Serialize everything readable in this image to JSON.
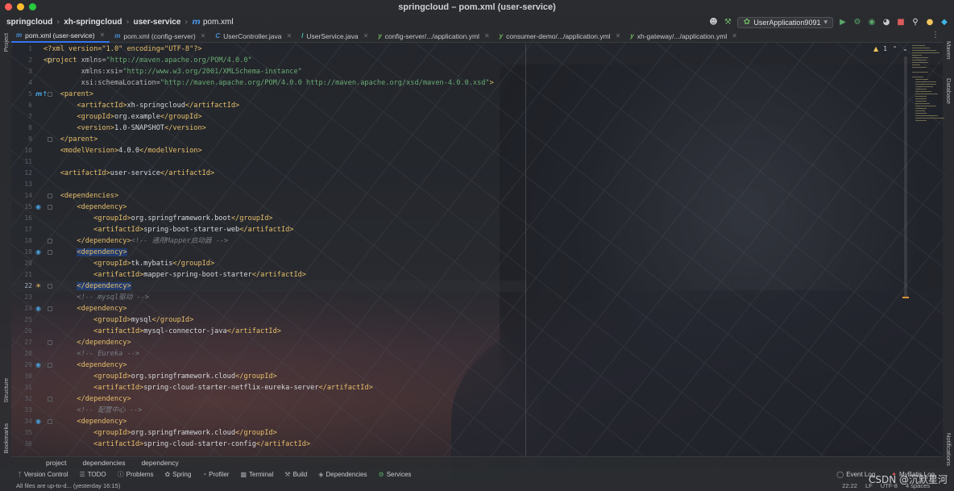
{
  "window": {
    "title": "springcloud – pom.xml (user-service)"
  },
  "breadcrumb": {
    "project": "springcloud",
    "module": "xh-springcloud",
    "submodule": "user-service",
    "file": "pom.xml"
  },
  "run_config": {
    "label": "UserApplication9091"
  },
  "tabs": [
    {
      "label": "pom.xml (user-service)",
      "icon": "maven-icon",
      "active": true
    },
    {
      "label": "pom.xml (config-server)",
      "icon": "maven-icon",
      "active": false
    },
    {
      "label": "UserController.java",
      "icon": "class-icon",
      "active": false
    },
    {
      "label": "UserService.java",
      "icon": "interface-icon",
      "active": false
    },
    {
      "label": "config-server/.../application.yml",
      "icon": "yaml-icon",
      "active": false
    },
    {
      "label": "consumer-demo/.../application.yml",
      "icon": "yaml-icon",
      "active": false
    },
    {
      "label": "xh-gateway/.../application.yml",
      "icon": "yaml-icon",
      "active": false
    }
  ],
  "left_stripe": {
    "project": "Project",
    "structure": "Structure",
    "bookmarks": "Bookmarks"
  },
  "right_stripe": {
    "maven": "Maven",
    "database": "Database",
    "notifications": "Notifications"
  },
  "inspection": {
    "warnings": "1"
  },
  "editor": {
    "current_line": 22,
    "line_numbers": [
      "1",
      "2",
      "3",
      "4",
      "5",
      "6",
      "7",
      "8",
      "9",
      "10",
      "11",
      "12",
      "13",
      "14",
      "15",
      "16",
      "17",
      "18",
      "19",
      "20",
      "21",
      "22",
      "23",
      "24",
      "25",
      "26",
      "27",
      "28",
      "29",
      "30",
      "31",
      "32",
      "33",
      "34",
      "35",
      "36"
    ],
    "lines": [
      [
        [
          "tg",
          "<?xml version=\"1.0\" encoding=\"UTF-8\"?>"
        ]
      ],
      [
        [
          "tg",
          "<project "
        ],
        [
          "an",
          "xmlns="
        ],
        [
          "av",
          "\"http://maven.apache.org/POM/4.0.0\""
        ]
      ],
      [
        [
          "an",
          "         xmlns:xsi="
        ],
        [
          "av",
          "\"http://www.w3.org/2001/XMLSchema-instance\""
        ]
      ],
      [
        [
          "an",
          "         xsi:schemaLocation="
        ],
        [
          "av",
          "\"http://maven.apache.org/POM/4.0.0 http://maven.apache.org/xsd/maven-4.0.0.xsd\""
        ],
        [
          "tg",
          ">"
        ]
      ],
      [
        [
          "tg",
          "    <parent>"
        ]
      ],
      [
        [
          "tg",
          "        <artifactId>"
        ],
        [
          "tx",
          "xh-springcloud"
        ],
        [
          "tg",
          "</artifactId>"
        ]
      ],
      [
        [
          "tg",
          "        <groupId>"
        ],
        [
          "tx",
          "org.example"
        ],
        [
          "tg",
          "</groupId>"
        ]
      ],
      [
        [
          "tg",
          "        <version>"
        ],
        [
          "tx",
          "1.0-SNAPSHOT"
        ],
        [
          "tg",
          "</version>"
        ]
      ],
      [
        [
          "tg",
          "    </parent>"
        ]
      ],
      [
        [
          "tg",
          "    <modelVersion>"
        ],
        [
          "tx",
          "4.0.0"
        ],
        [
          "tg",
          "</modelVersion>"
        ]
      ],
      [
        [
          "tx",
          ""
        ]
      ],
      [
        [
          "tg",
          "    <artifactId>"
        ],
        [
          "tx",
          "user-service"
        ],
        [
          "tg",
          "</artifactId>"
        ]
      ],
      [
        [
          "tx",
          ""
        ]
      ],
      [
        [
          "tg",
          "    <dependencies>"
        ]
      ],
      [
        [
          "tg",
          "        <dependency>"
        ]
      ],
      [
        [
          "tg",
          "            <groupId>"
        ],
        [
          "tx",
          "org.springframework.boot"
        ],
        [
          "tg",
          "</groupId>"
        ]
      ],
      [
        [
          "tg",
          "            <artifactId>"
        ],
        [
          "tx",
          "spring-boot-starter-web"
        ],
        [
          "tg",
          "</artifactId>"
        ]
      ],
      [
        [
          "tg",
          "        </dependency>"
        ],
        [
          "cm",
          "<!-- 通用Mapper启动器 -->"
        ]
      ],
      [
        [
          "tx",
          "        "
        ],
        [
          "sel",
          "<dependency>"
        ]
      ],
      [
        [
          "tg",
          "            <groupId>"
        ],
        [
          "tx",
          "tk.mybatis"
        ],
        [
          "tg",
          "</groupId>"
        ]
      ],
      [
        [
          "tg",
          "            <artifactId>"
        ],
        [
          "tx",
          "mapper-spring-boot-starter"
        ],
        [
          "tg",
          "</artifactId>"
        ]
      ],
      [
        [
          "tx",
          "        "
        ],
        [
          "sel",
          "</dependency>"
        ]
      ],
      [
        [
          "cm",
          "        <!-- mysql驱动 -->"
        ]
      ],
      [
        [
          "tg",
          "        <dependency>"
        ]
      ],
      [
        [
          "tg",
          "            <groupId>"
        ],
        [
          "tx",
          "mysql"
        ],
        [
          "tg",
          "</groupId>"
        ]
      ],
      [
        [
          "tg",
          "            <artifactId>"
        ],
        [
          "tx",
          "mysql-connector-java"
        ],
        [
          "tg",
          "</artifactId>"
        ]
      ],
      [
        [
          "tg",
          "        </dependency>"
        ]
      ],
      [
        [
          "cm",
          "        <!-- Eureka -->"
        ]
      ],
      [
        [
          "tg",
          "        <dependency>"
        ]
      ],
      [
        [
          "tg",
          "            <groupId>"
        ],
        [
          "tx",
          "org.springframework.cloud"
        ],
        [
          "tg",
          "</groupId>"
        ]
      ],
      [
        [
          "tg",
          "            <artifactId>"
        ],
        [
          "tx",
          "spring-cloud-starter-netflix-eureka-server"
        ],
        [
          "tg",
          "</artifactId>"
        ]
      ],
      [
        [
          "tg",
          "        </dependency>"
        ]
      ],
      [
        [
          "cm",
          "        <!-- 配置中心 -->"
        ]
      ],
      [
        [
          "tg",
          "        <dependency>"
        ]
      ],
      [
        [
          "tg",
          "            <groupId>"
        ],
        [
          "tx",
          "org.springframework.cloud"
        ],
        [
          "tg",
          "</groupId>"
        ]
      ],
      [
        [
          "tg",
          "            <artifactId>"
        ],
        [
          "tx",
          "spring-cloud-starter-config"
        ],
        [
          "tg",
          "</artifactId>"
        ]
      ]
    ]
  },
  "bottom_breadcrumb": [
    "project",
    "dependencies",
    "dependency"
  ],
  "tool_windows": {
    "version_control": "Version Control",
    "todo": "TODO",
    "problems": "Problems",
    "spring": "Spring",
    "profiler": "Profiler",
    "terminal": "Terminal",
    "build": "Build",
    "dependencies": "Dependencies",
    "services": "Services",
    "event_log": "Event Log",
    "mybatis_log": "MyBatis Log"
  },
  "status": {
    "message": "All files are up-to-d... (yesterday 16:15)",
    "position": "22:22",
    "line_sep": "LF",
    "encoding": "UTF-8",
    "indent": "4 spaces"
  },
  "watermark": "CSDN @沉默星河",
  "colors": {
    "tag": "#e8bf6a",
    "value": "#6aab73",
    "comment": "#7a7e85",
    "selection": "#214283",
    "accent": "#3574f0"
  }
}
